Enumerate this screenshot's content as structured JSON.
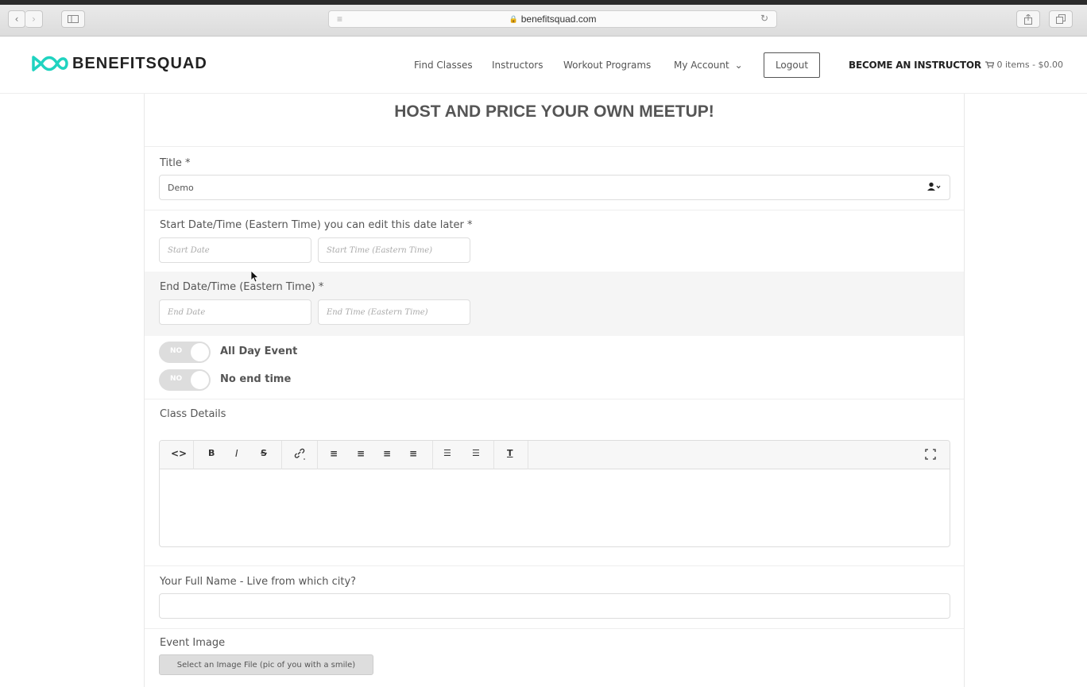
{
  "browser": {
    "url": "benefitsquad.com",
    "back_icon": "chevron-left",
    "forward_icon": "chevron-right",
    "sidebar_icon": "sidebar",
    "reader_icon": "reader-lines",
    "reload_icon": "reload",
    "share_icon": "share",
    "tabs_icon": "tabs"
  },
  "header": {
    "brand": "BENEFITSQUAD",
    "brand_color": "#1fd3c0",
    "nav": {
      "find_classes": "Find Classes",
      "instructors": "Instructors",
      "workout_programs": "Workout Programs",
      "my_account": "My Account",
      "my_account_chevron": "⌄"
    },
    "logout": "Logout",
    "become_instructor": "BECOME AN INSTRUCTOR",
    "cart": "0 items - $0.00",
    "cart_icon": "cart"
  },
  "form": {
    "page_title": "HOST AND PRICE YOUR OWN MEETUP!",
    "title_label": "Title *",
    "title_value": "Demo",
    "title_icon": "user-dropdown",
    "start_label": "Start Date/Time (Eastern Time) you can edit this date later *",
    "start_date_placeholder": "Start Date",
    "start_time_placeholder": "Start Time (Eastern Time)",
    "end_label": "End Date/Time (Eastern Time) *",
    "end_date_placeholder": "End Date",
    "end_time_placeholder": "End Time (Eastern Time)",
    "all_day": {
      "state": "NO",
      "label": "All Day Event"
    },
    "no_end": {
      "state": "NO",
      "label": "No end time"
    },
    "details_label": "Class Details",
    "toolbar": {
      "code": "<>",
      "bold": "B",
      "italic": "I",
      "strike": "S",
      "link": "link",
      "align_left": "≡",
      "align_center": "≡",
      "align_right": "≡",
      "align_justify": "≡",
      "ul": "☰",
      "ol": "☰",
      "clear_format": "T",
      "fullscreen": "fullscreen"
    },
    "fullname_label": "Your Full Name - Live from which city?",
    "fullname_value": "",
    "image_label": "Event Image",
    "image_button": "Select an Image File (pic of you with a smile)"
  }
}
